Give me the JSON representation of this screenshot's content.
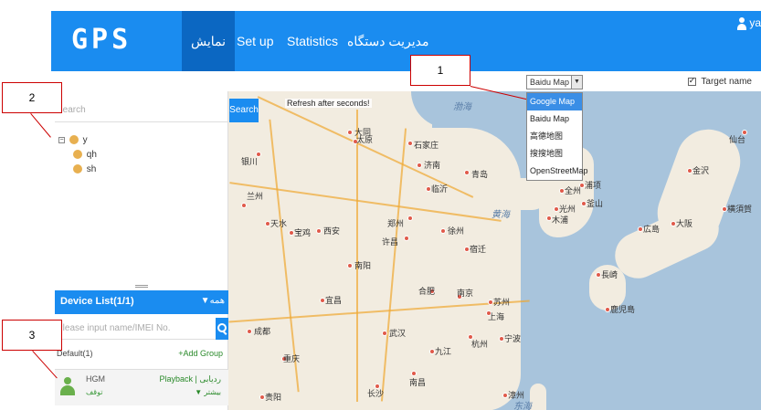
{
  "header": {
    "logo": "GPS",
    "tabs": [
      {
        "label": "نمایش",
        "active": true
      },
      {
        "label": "Set up",
        "active": false
      },
      {
        "label": "Statistics",
        "active": false
      },
      {
        "label": "مدیریت دستگاه",
        "active": false
      }
    ],
    "user": "ya"
  },
  "map": {
    "refresh_note": "Refresh after seconds!",
    "type_select": {
      "selected": "Baidu Map",
      "options": [
        "Google Map",
        "Baidu Map",
        "高德地图",
        "搜搜地图",
        "OpenStreetMap"
      ],
      "highlighted": "Google Map"
    },
    "target_name_label": "Target name",
    "target_name_checked": true,
    "cities": [
      "大同",
      "太原",
      "石家庄",
      "济南",
      "青岛",
      "郑州",
      "西安",
      "武汉",
      "合肥",
      "南京",
      "上海",
      "杭州",
      "长沙",
      "南昌",
      "成都",
      "重庆",
      "银川",
      "兰州",
      "天水",
      "宝鸡",
      "临沂",
      "徐州",
      "宿迁",
      "苏州",
      "宁波",
      "漳州",
      "许昌",
      "南阳",
      "宜昌",
      "贵阳",
      "九江",
      "仙台",
      "金沢",
      "大阪",
      "広島",
      "長崎",
      "鹿児島",
      "浦项",
      "釜山",
      "光州",
      "全州",
      "木浦",
      "横須賀"
    ],
    "seas": [
      "渤海",
      "黄海",
      "东海"
    ]
  },
  "left_panel": {
    "search_placeholder": "Search",
    "search_button": "Search",
    "tree": {
      "root": "y",
      "children": [
        "qh",
        "sh"
      ]
    },
    "device_list": {
      "title": "Device List(1/1)",
      "filter": "▼همه",
      "search_placeholder": "Please input name/IMEI No.",
      "group": "Default(1)",
      "add_group": "+Add Group",
      "devices": [
        {
          "name": "HGM",
          "status": "توقف",
          "links": "Playback | ردیابی",
          "more": "▼ بیشتر"
        }
      ]
    }
  },
  "annotations": [
    "1",
    "2",
    "3"
  ],
  "colors": {
    "primary": "#1a8cf0",
    "active_tab": "#0b67c2",
    "callout_border": "#cc0000"
  }
}
